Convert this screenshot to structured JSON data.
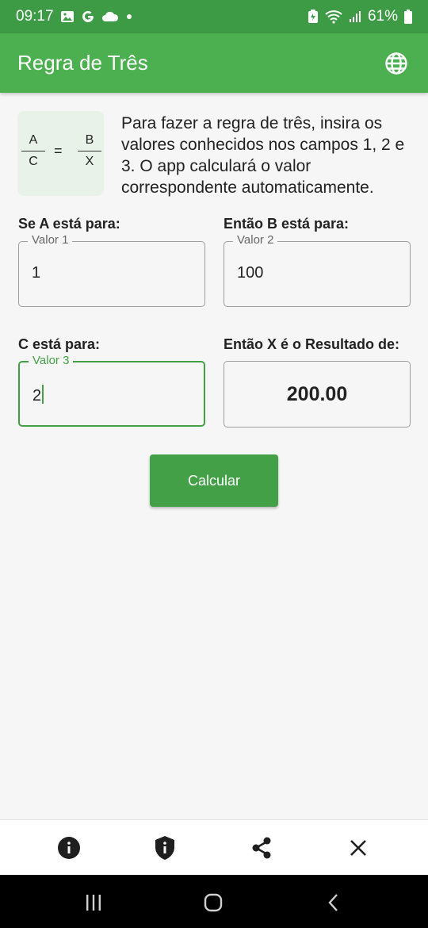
{
  "status_bar": {
    "time": "09:17",
    "battery": "61%"
  },
  "app_bar": {
    "title": "Regra de Três"
  },
  "intro": {
    "formula": {
      "a": "A",
      "b": "B",
      "c": "C",
      "x": "X",
      "equals": "="
    },
    "description": "Para fazer a regra de três, insira os valores conhecidos nos campos 1, 2 e 3. O app calculará o valor correspondente automaticamente."
  },
  "fields": {
    "a": {
      "label": "Se A está para:",
      "legend": "Valor 1",
      "value": "1"
    },
    "b": {
      "label": "Então B está para:",
      "legend": "Valor 2",
      "value": "100"
    },
    "c": {
      "label": "C está para:",
      "legend": "Valor 3",
      "value": "2"
    },
    "result": {
      "label": "Então X é o Resultado de:",
      "value": "200.00"
    }
  },
  "calculate_button": {
    "label": "Calcular"
  },
  "bottom_bar": {
    "icons": [
      "info-icon",
      "shield-icon",
      "share-icon",
      "close-icon"
    ]
  },
  "colors": {
    "primary": "#4caf50",
    "status_bar": "#3d9b45",
    "accent": "#43a047"
  }
}
